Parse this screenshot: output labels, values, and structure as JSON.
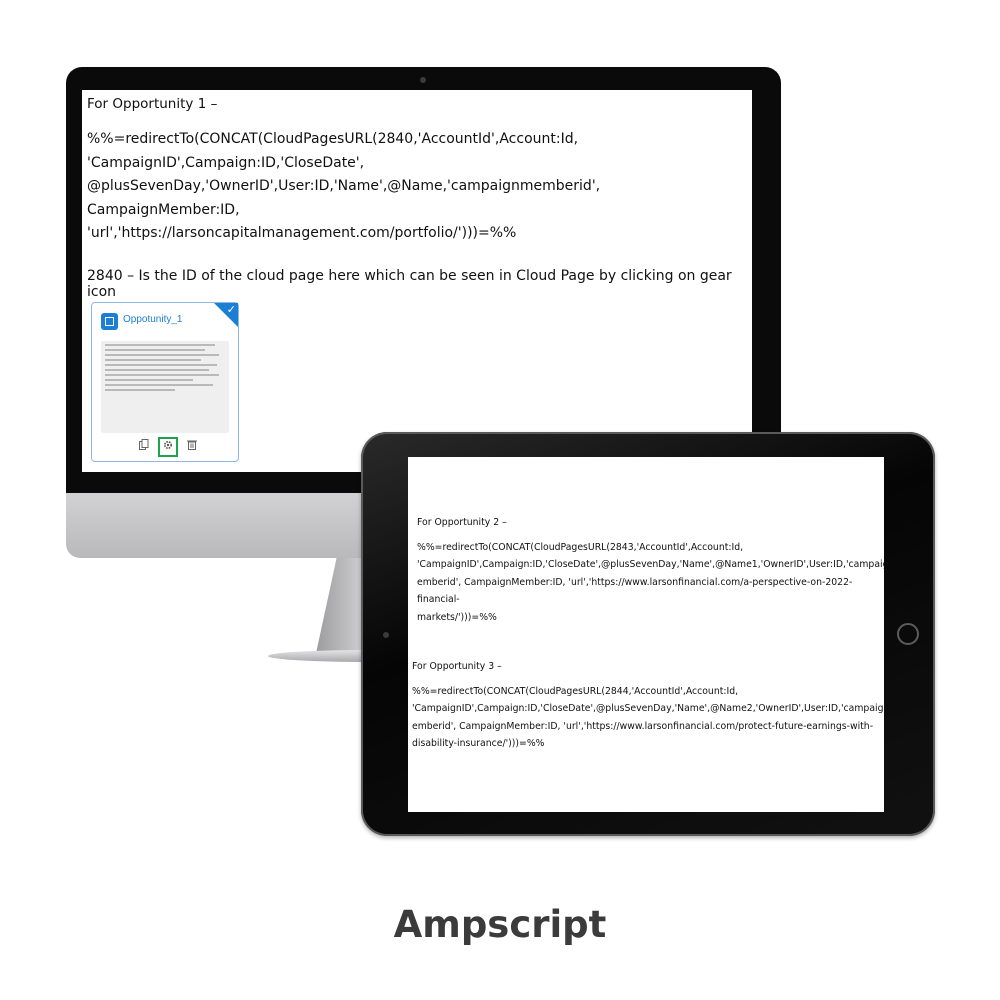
{
  "monitor": {
    "title": "For Opportunity 1 –",
    "code": "%%=redirectTo(CONCAT(CloudPagesURL(2840,'AccountId',Account:Id,\n'CampaignID',Campaign:ID,'CloseDate',\n@plusSevenDay,'OwnerID',User:ID,'Name',@Name,'campaignmemberid', CampaignMember:ID,\n'url','https://larsoncapitalmanagement.com/portfolio/')))=%%",
    "note": "2840 – Is the ID of the cloud page here which can be seen in Cloud Page by clicking on gear icon",
    "card": {
      "name": "Oppotunity_1",
      "check": "✓",
      "icons": [
        "copy-icon",
        "gear-icon",
        "trash-icon"
      ]
    }
  },
  "tablet": {
    "op2_title": "For Opportunity 2 –",
    "op2_code": "%%=redirectTo(CONCAT(CloudPagesURL(2843,'AccountId',Account:Id,\n'CampaignID',Campaign:ID,'CloseDate',@plusSevenDay,'Name',@Name1,'OwnerID',User:ID,'campaignm\nemberid', CampaignMember:ID, 'url','https://www.larsonfinancial.com/a-perspective-on-2022-financial-\nmarkets/')))=%%",
    "op3_title": "For Opportunity 3 –",
    "op3_code": "%%=redirectTo(CONCAT(CloudPagesURL(2844,'AccountId',Account:Id,\n'CampaignID',Campaign:ID,'CloseDate',@plusSevenDay,'Name',@Name2,'OwnerID',User:ID,'campaignm\nemberid', CampaignMember:ID, 'url','https://www.larsonfinancial.com/protect-future-earnings-with-\ndisability-insurance/')))=%%"
  },
  "caption": "Ampscript"
}
